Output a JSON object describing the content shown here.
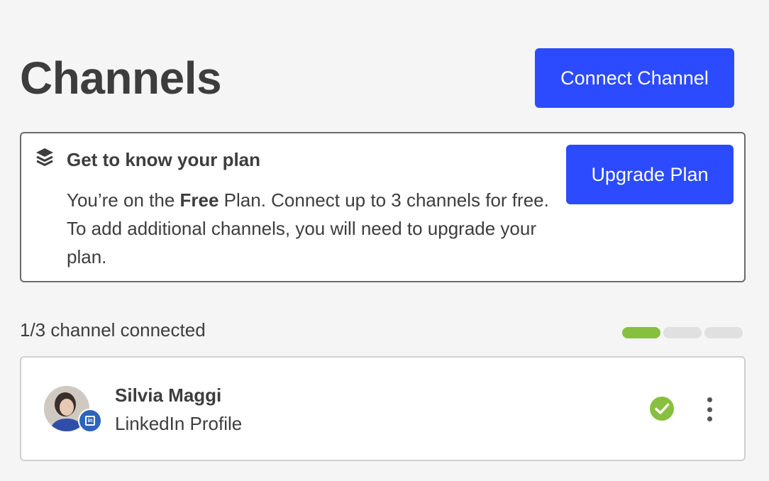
{
  "header": {
    "title": "Channels",
    "connect_button": "Connect Channel"
  },
  "plan_card": {
    "icon": "layers-icon",
    "heading": "Get to know your plan",
    "text_before": "You’re on the ",
    "plan_name": "Free",
    "text_after": " Plan. Connect up to 3 channels for free. To add additional channels, you will need to upgrade your plan.",
    "upgrade_button": "Upgrade Plan"
  },
  "usage": {
    "label": "1/3 channel connected",
    "connected": 1,
    "limit": 3
  },
  "channels": [
    {
      "name": "Silvia Maggi",
      "type": "LinkedIn Profile",
      "network_icon": "linkedin-icon",
      "status_icon": "check-circle-icon",
      "status_color": "#87c03f"
    }
  ],
  "colors": {
    "accent": "#2c4bff",
    "success": "#87c03f",
    "linkedin": "#2d64bc"
  }
}
